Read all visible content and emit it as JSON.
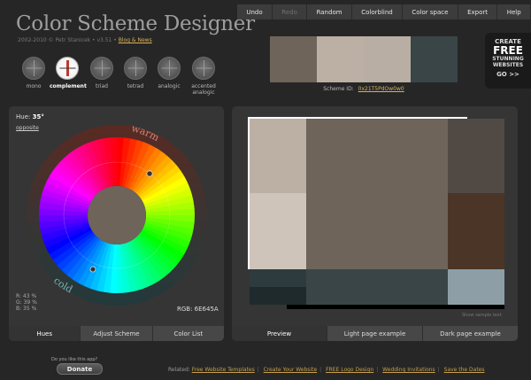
{
  "app": {
    "title": "Color Scheme Designer",
    "credits_prefix": "2002-2010 © Petr Stanicek • v3.51 •",
    "credits_link": "Blog & News"
  },
  "menu": [
    {
      "label": "Undo",
      "enabled": true
    },
    {
      "label": "Redo",
      "enabled": false
    },
    {
      "label": "Random",
      "enabled": true
    },
    {
      "label": "Colorblind",
      "enabled": true
    },
    {
      "label": "Color space",
      "enabled": true
    },
    {
      "label": "Export",
      "enabled": true
    },
    {
      "label": "Help",
      "enabled": true
    }
  ],
  "scheme_types": [
    {
      "label": "mono",
      "active": false
    },
    {
      "label": "complement",
      "active": true
    },
    {
      "label": "triad",
      "active": false
    },
    {
      "label": "tetrad",
      "active": false
    },
    {
      "label": "analogic",
      "active": false
    },
    {
      "label": "accented analogic",
      "active": false
    }
  ],
  "swatches": [
    "#6e645a",
    "#bcafa4",
    "#b9aea3",
    "#3a4547"
  ],
  "scheme_id": {
    "label": "Scheme ID:",
    "value": "0x21T5PdOw0w0"
  },
  "promo": {
    "line1": "CREATE",
    "line2": "FREE",
    "line3": "STUNNING WEBSITES",
    "line4": "GO >>"
  },
  "hue": {
    "label": "Hue:",
    "value": "35°",
    "opposite_link": "opposite"
  },
  "wheel": {
    "warm_label": "warm",
    "cold_label": "cold",
    "center_color": "#6e645a"
  },
  "rgb": {
    "r": "R: 43 %",
    "g": "G: 39 %",
    "b": "B: 35 %",
    "hex_label": "RGB: 6E645A"
  },
  "left_tabs": [
    {
      "label": "Hues",
      "active": true
    },
    {
      "label": "Adjust Scheme",
      "active": false
    },
    {
      "label": "Color List",
      "active": false
    }
  ],
  "preview": {
    "colors": {
      "light": "#bcafa4",
      "light2": "#cfc4ba",
      "main": "#6e645a",
      "side_top": "#514a44",
      "side_mid": "#4a3526",
      "bottom_left": "#2e3b3e",
      "bottom_left2": "#1f2a2c",
      "bottom_mid": "#3a4547",
      "bottom_right": "#8d9ea6",
      "frame": "#ffffff",
      "shadow": "#000000"
    },
    "note": "Show sample text"
  },
  "right_tabs": [
    {
      "label": "Preview",
      "active": true
    },
    {
      "label": "Light page example",
      "active": false
    },
    {
      "label": "Dark page example",
      "active": false
    }
  ],
  "footer": {
    "donate_question": "Do you like this app?",
    "donate_label": "Donate",
    "related_label": "Related:",
    "links": [
      "Free Website Templates",
      "Create Your Website",
      "FREE Logo Design",
      "Wedding Invitations",
      "Save the Dates"
    ]
  }
}
